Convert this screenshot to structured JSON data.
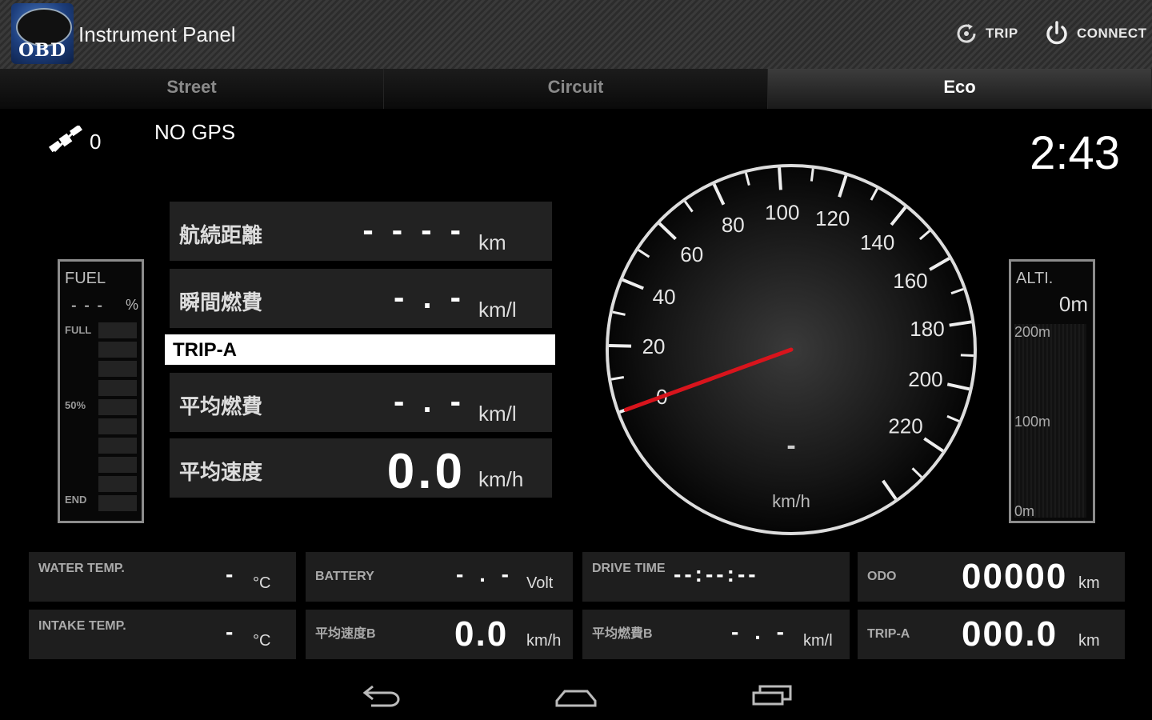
{
  "app": {
    "title": "Instrument Panel",
    "icon_text": "OBD"
  },
  "actions": {
    "trip_label": "TRIP",
    "connect_label": "CONNECT"
  },
  "tabs": [
    {
      "label": "Street",
      "active": false
    },
    {
      "label": "Circuit",
      "active": false
    },
    {
      "label": "Eco",
      "active": true
    }
  ],
  "gps": {
    "satellites": "0",
    "status": "NO GPS"
  },
  "clock": "2:43",
  "fuel": {
    "label": "FUEL",
    "value": "- - -",
    "unit": "%",
    "full": "FULL",
    "half": "50%",
    "end": "END"
  },
  "alti": {
    "label": "ALTI.",
    "value": "0m",
    "ticks": [
      "200m",
      "100m",
      "0m"
    ]
  },
  "info_rows": [
    {
      "label": "航続距離",
      "value": "- - - -",
      "unit": "km"
    },
    {
      "label": "瞬間燃費",
      "value": "- . -",
      "unit": "km/l"
    },
    {
      "label": "平均燃費",
      "value": "- . -",
      "unit": "km/l"
    },
    {
      "label": "平均速度",
      "value": "0.0",
      "unit": "km/h"
    }
  ],
  "trip_header": "TRIP-A",
  "speedometer": {
    "labels": [
      "0",
      "20",
      "40",
      "60",
      "80",
      "100",
      "120",
      "140",
      "160",
      "180",
      "200",
      "220"
    ],
    "min": 0,
    "max": 240,
    "speed": 0,
    "readout": "-",
    "unit": "km/h"
  },
  "bottom": [
    {
      "label": "WATER TEMP.",
      "value": "-",
      "unit": "°C"
    },
    {
      "label": "BATTERY",
      "value": "- . -",
      "unit": "Volt"
    },
    {
      "label": "DRIVE TIME",
      "value": "--:--:--",
      "unit": ""
    },
    {
      "label": "ODO",
      "value": "00000",
      "unit": "km"
    },
    {
      "label": "INTAKE TEMP.",
      "value": "-",
      "unit": "°C"
    },
    {
      "label": "平均速度B",
      "value": "0.0",
      "unit": "km/h"
    },
    {
      "label": "平均燃費B",
      "value": "- . -",
      "unit": "km/l"
    },
    {
      "label": "TRIP-A",
      "value": "000.0",
      "unit": "km"
    }
  ],
  "colors": {
    "needle": "#d8141c",
    "panel": "#222222",
    "background": "#000000"
  },
  "nav_icons": [
    "back-icon",
    "home-icon",
    "recents-icon"
  ]
}
